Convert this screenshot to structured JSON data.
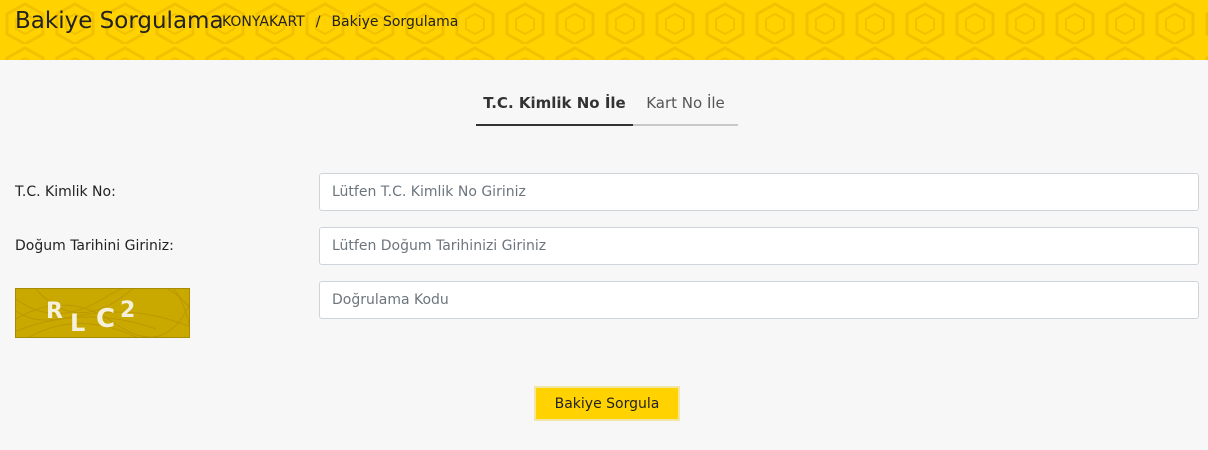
{
  "header": {
    "title": "Bakiye Sorgulama",
    "breadcrumb": [
      {
        "label": "KONYAKART"
      },
      {
        "label": "Bakiye Sorgulama"
      }
    ],
    "separator": "/",
    "background_color": "#ffd200"
  },
  "tabs": [
    {
      "label": "T.C. Kimlik No İle",
      "active": true
    },
    {
      "label": "Kart No İle",
      "active": false
    }
  ],
  "form": {
    "tc_label": "T.C. Kimlik No:",
    "tc_placeholder": "Lütfen T.C. Kimlik No Giriniz",
    "birth_label": "Doğum Tarihini Giriniz:",
    "birth_placeholder": "Lütfen Doğum Tarihinizi Giriniz",
    "captcha_placeholder": "Doğrulama Kodu",
    "captcha_image_text": "RLC²"
  },
  "submit_label": "Bakiye Sorgula",
  "accent_color": "#ffd200"
}
